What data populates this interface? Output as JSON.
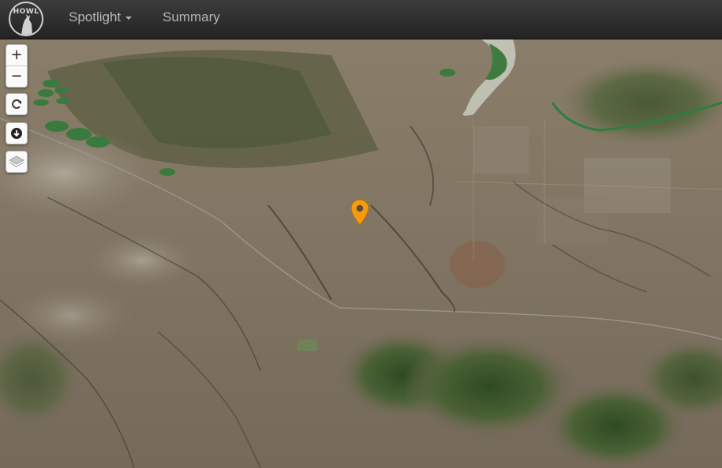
{
  "nav": {
    "logo_text": "HOWL",
    "items": [
      {
        "label": "Spotlight",
        "has_dropdown": true,
        "icon": "chevron-down-icon"
      },
      {
        "label": "Summary",
        "has_dropdown": false
      }
    ]
  },
  "map_controls": {
    "zoom_in": "+",
    "zoom_out": "−",
    "refresh_icon": "refresh-icon",
    "download_icon": "download-icon",
    "layers_icon": "layers-icon"
  },
  "map": {
    "view": "3D oblique satellite imagery",
    "marker": {
      "icon": "map-pin-icon",
      "color": "#f39c12"
    }
  },
  "colors": {
    "navbar": "#2b2b2b",
    "nav_text": "#b7b7b7",
    "marker": "#f39c12",
    "terrain": "#7a6e5c",
    "vegetation": "#3f5a30",
    "river": "#2f7d3e"
  }
}
